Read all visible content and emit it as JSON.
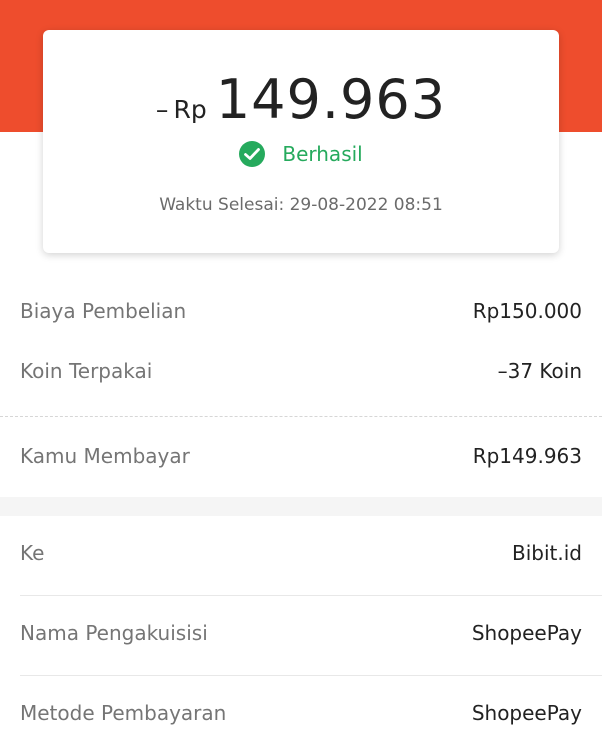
{
  "summary": {
    "sign": "–",
    "currency": "Rp",
    "amount": "149.963",
    "status": "Berhasil",
    "time": "Waktu Selesai: 29-08-2022 08:51"
  },
  "payment": {
    "rows": [
      {
        "label": "Biaya Pembelian",
        "value": "Rp150.000"
      },
      {
        "label": "Koin Terpakai",
        "value": "–37 Koin"
      }
    ],
    "total": {
      "label": "Kamu Membayar",
      "value": "Rp149.963"
    }
  },
  "details": {
    "rows": [
      {
        "label": "Ke",
        "value": "Bibit.id"
      },
      {
        "label": "Nama Pengakuisisi",
        "value": "ShopeePay"
      },
      {
        "label": "Metode Pembayaran",
        "value": "ShopeePay"
      }
    ]
  },
  "colors": {
    "header": "#ee4d2d",
    "success": "#26aa5d"
  },
  "icons": {
    "status": "check-circle-icon"
  }
}
